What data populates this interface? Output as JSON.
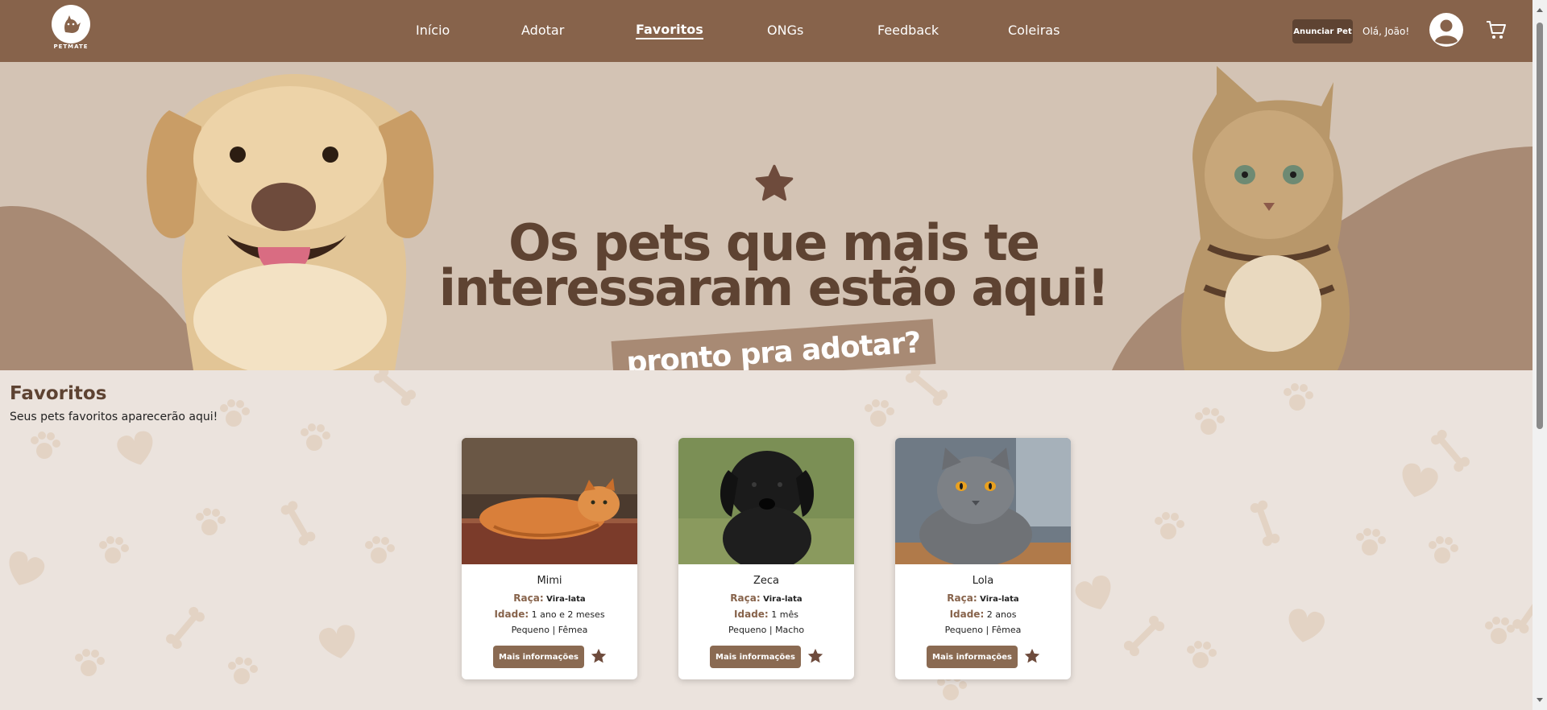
{
  "brand": {
    "logo_text": "PETMATE"
  },
  "nav": {
    "links": [
      {
        "label": "Início"
      },
      {
        "label": "Adotar"
      },
      {
        "label": "Favoritos"
      },
      {
        "label": "ONGs"
      },
      {
        "label": "Feedback"
      },
      {
        "label": "Coleiras"
      }
    ],
    "active": "Favoritos",
    "announce_button": "Anunciar Pet",
    "greeting": "Olá, João!"
  },
  "hero": {
    "title_line1": "Os pets que mais te",
    "title_line2": "interessaram estão aqui!",
    "tagline": "pronto pra adotar?"
  },
  "favorites": {
    "title": "Favoritos",
    "subtitle": "Seus pets favoritos aparecerão aqui!",
    "breed_label": "Raça:",
    "age_label": "Idade:",
    "button_label": "Mais informações",
    "pets": [
      {
        "name": "Mimi",
        "breed": "Vira-lata",
        "age": "1 ano e 2 meses",
        "traits": "Pequeno | Fêmea"
      },
      {
        "name": "Zeca",
        "breed": "Vira-lata",
        "age": "1 mês",
        "traits": "Pequeno | Macho"
      },
      {
        "name": "Lola",
        "breed": "Vira-lata",
        "age": "2 anos",
        "traits": "Pequeno | Fêmea"
      }
    ]
  },
  "colors": {
    "nav_bg": "#87634b",
    "hero_bg": "#d3c3b4",
    "accent_dark": "#5e4332",
    "page_bg": "#ebe3dd",
    "button": "#8a6a52"
  },
  "icons": [
    "paw-logo-icon",
    "user-avatar-icon",
    "cart-icon",
    "star-icon"
  ]
}
